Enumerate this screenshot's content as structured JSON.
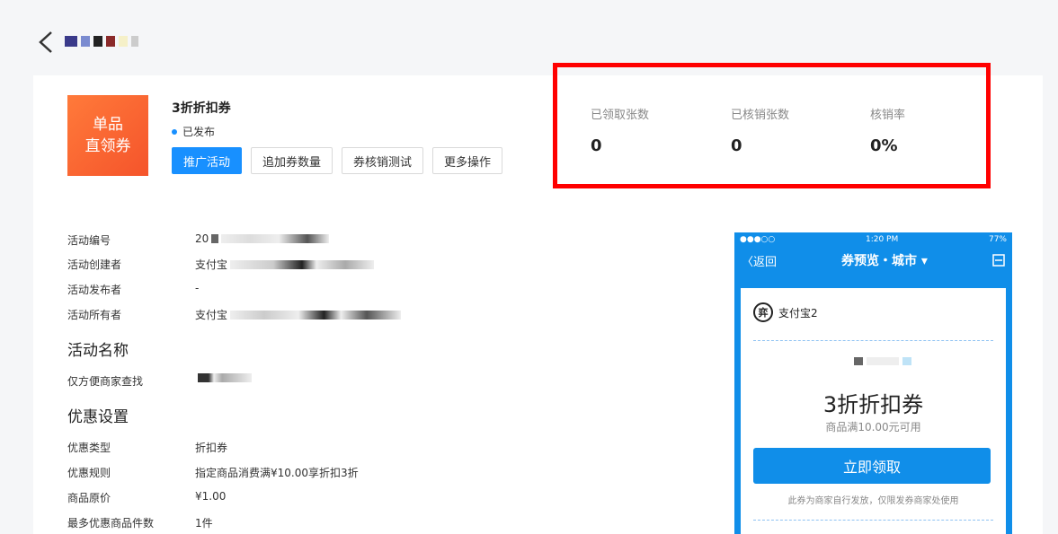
{
  "header": {
    "back_icon": "chevron-left-icon"
  },
  "coupon": {
    "badge_line1": "单品",
    "badge_line2": "直领券",
    "title": "3折折扣券",
    "status": "已发布",
    "buttons": [
      "推广活动",
      "追加券数量",
      "券核销测试",
      "更多操作"
    ]
  },
  "stats": [
    {
      "label": "已领取张数",
      "value": "0"
    },
    {
      "label": "已核销张数",
      "value": "0"
    },
    {
      "label": "核销率",
      "value": "0%"
    }
  ],
  "details": {
    "activity_rows": [
      {
        "key": "活动编号",
        "value": "20"
      },
      {
        "key": "活动创建者",
        "value": "支付宝"
      },
      {
        "key": "活动发布者",
        "value": "-"
      },
      {
        "key": "活动所有者",
        "value": "支付宝"
      }
    ],
    "section_name": "活动名称",
    "name_row": {
      "key": "仅方便商家查找",
      "value": ""
    },
    "section_discount": "优惠设置",
    "discount_rows": [
      {
        "key": "优惠类型",
        "value": "折扣券"
      },
      {
        "key": "优惠规则",
        "value": "指定商品消费满¥10.00享折扣3折"
      },
      {
        "key": "商品原价",
        "value": "¥1.00"
      },
      {
        "key": "最多优惠商品件数",
        "value": "1件"
      }
    ]
  },
  "preview": {
    "status_left": "●●●○○",
    "time": "1:20 PM",
    "battery": "77%",
    "back_label": "〈返回",
    "nav_title": "券预览・城市 ▾",
    "merchant_logo": "弈",
    "merchant_name": "支付宝2",
    "coupon_name": "3折折扣券",
    "condition": "商品满10.00元可用",
    "button": "立即领取",
    "note": "此券为商家自行发放，仅限发券商家处使用"
  }
}
